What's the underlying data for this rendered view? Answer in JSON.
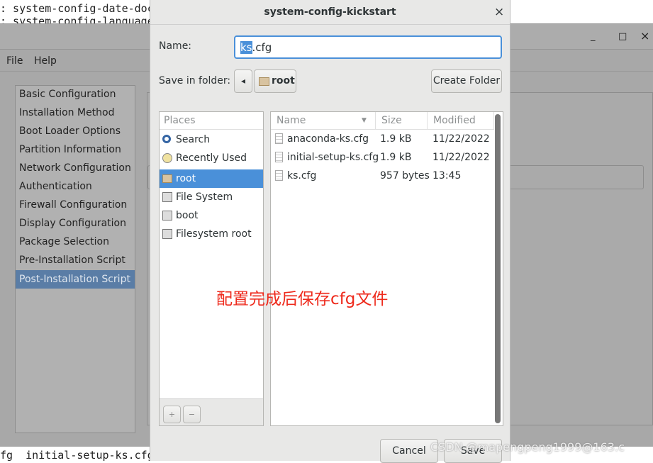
{
  "terminal": {
    "line1": ": system-config-date-doc",
    "line2": ": system-config-language",
    "bottom_line": "fg  initial-setup-ks.cfg"
  },
  "bg_window": {
    "controls": {
      "minimize": "_",
      "maximize": "□",
      "close": "×"
    },
    "menu": [
      "File",
      "Help"
    ],
    "sidebar": [
      "Basic Configuration",
      "Installation Method",
      "Boot Loader Options",
      "Partition Information",
      "Network Configuration",
      "Authentication",
      "Firewall Configuration",
      "Display Configuration",
      "Package Selection",
      "Pre-Installation Script",
      "Post-Installation Script"
    ],
    "selected": "Post-Installation Script"
  },
  "dialog": {
    "title": "system-config-kickstart",
    "close": "×",
    "name_label": "Name:",
    "name_selected": "ks",
    "name_rest": ".cfg",
    "save_in_label": "Save in folder:",
    "back": "◂",
    "folder": "root",
    "create_folder": "Create Folder",
    "places_header": "Places",
    "places": [
      {
        "label": "Search",
        "icon": "search-icon"
      },
      {
        "label": "Recently Used",
        "icon": "clock-icon"
      },
      {
        "label": "root",
        "icon": "home-folder-icon",
        "selected": true
      },
      {
        "label": "File System",
        "icon": "drive-icon"
      },
      {
        "label": "boot",
        "icon": "drive-icon"
      },
      {
        "label": "Filesystem root",
        "icon": "drive-icon"
      }
    ],
    "add": "+",
    "remove": "−",
    "columns": {
      "name": "Name",
      "size": "Size",
      "modified": "Modified"
    },
    "files": [
      {
        "name": "anaconda-ks.cfg",
        "size": "1.9 kB",
        "modified": "11/22/2022"
      },
      {
        "name": "initial-setup-ks.cfg",
        "size": "1.9 kB",
        "modified": "11/22/2022"
      },
      {
        "name": "ks.cfg",
        "size": "957 bytes",
        "modified": "13:45"
      }
    ],
    "cancel": "Cancel",
    "save": "Save"
  },
  "annotation": "配置完成后保存cfg文件",
  "watermark": "CSDN @mapengpeng1999@163.c",
  "colors": {
    "accent": "#4a90d9",
    "annotation": "#ee2a1c"
  }
}
